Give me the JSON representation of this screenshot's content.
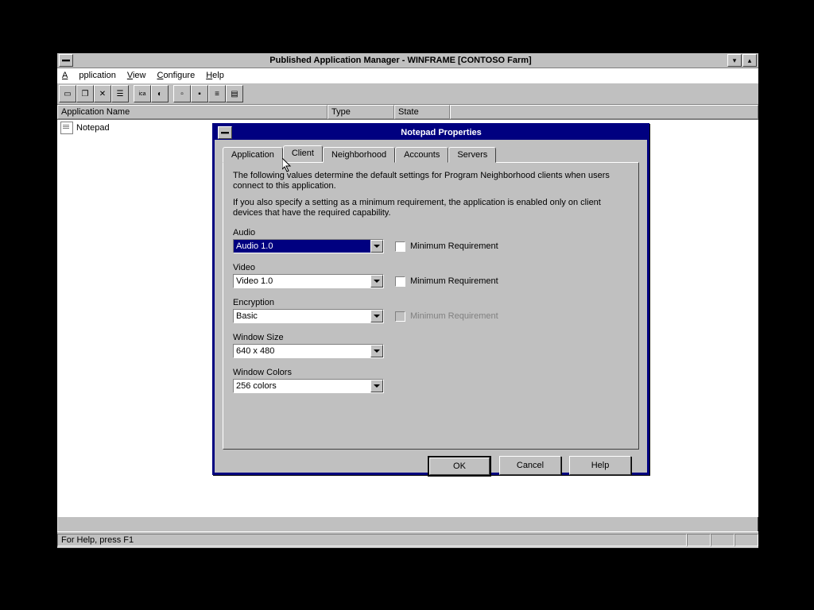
{
  "main_window": {
    "title": "Published Application Manager - WINFRAME [CONTOSO Farm]",
    "menus": {
      "application": "Application",
      "view": "View",
      "configure": "Configure",
      "help": "Help"
    },
    "columns": {
      "name": "Application Name",
      "type": "Type",
      "state": "State"
    },
    "list": [
      {
        "name": "Notepad"
      }
    ],
    "status": "For Help, press F1"
  },
  "dialog": {
    "title": "Notepad Properties",
    "tabs": {
      "application": "Application",
      "client": "Client",
      "neighborhood": "Neighborhood",
      "accounts": "Accounts",
      "servers": "Servers"
    },
    "desc1": "The following values determine the default settings for Program Neighborhood clients when users connect to this application.",
    "desc2": "If you also specify a setting as a minimum requirement, the application is enabled only on client devices that have the required capability.",
    "fields": {
      "audio": {
        "label": "Audio",
        "value": "Audio 1.0",
        "minreq": "Minimum Requirement"
      },
      "video": {
        "label": "Video",
        "value": "Video 1.0",
        "minreq": "Minimum Requirement"
      },
      "encryption": {
        "label": "Encryption",
        "value": "Basic",
        "minreq": "Minimum Requirement"
      },
      "winsize": {
        "label": "Window Size",
        "value": "640 x 480"
      },
      "wincolors": {
        "label": "Window Colors",
        "value": "256 colors"
      }
    },
    "buttons": {
      "ok": "OK",
      "cancel": "Cancel",
      "help": "Help"
    }
  }
}
